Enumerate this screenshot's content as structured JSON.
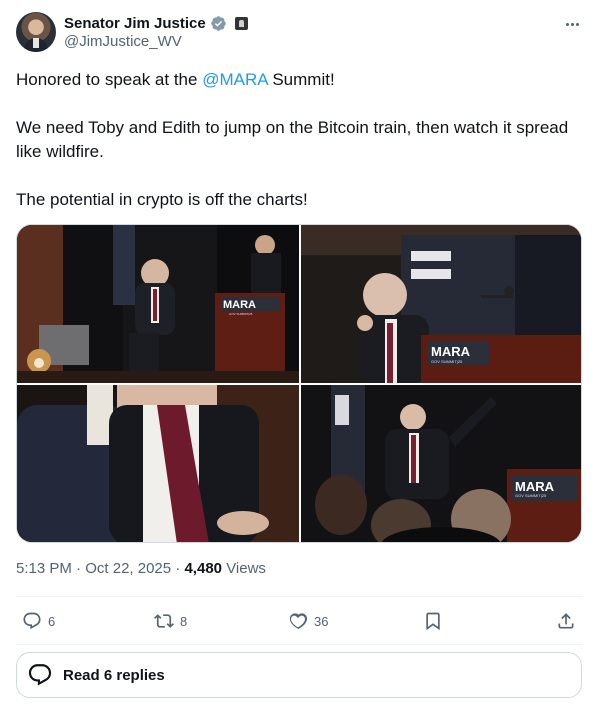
{
  "author": {
    "display_name": "Senator Jim Justice",
    "handle": "@JimJustice_WV",
    "verified": true,
    "badge_icon": "government-affiliation-icon"
  },
  "tweet": {
    "text_before_mention": "Honored to speak at the ",
    "mention": "@MARA",
    "text_after_mention": " Summit!",
    "paragraph_2": "We need Toby and Edith to jump on the Bitcoin train, then watch it spread like wildfire.",
    "paragraph_3": "The potential in crypto is off the charts!"
  },
  "media": {
    "photos": [
      {
        "description_icon": "photo-stage-seated",
        "sign_text": "MARA",
        "sign_subtext": "GOV SUMMIT|25"
      },
      {
        "description_icon": "photo-speaker-closeup",
        "sign_text": "MARA",
        "sign_subtext": "GOV SUMMIT|25"
      },
      {
        "description_icon": "photo-side-profile"
      },
      {
        "description_icon": "photo-audience-view",
        "sign_text": "MARA",
        "sign_subtext": "GOV SUMMIT|25"
      }
    ]
  },
  "meta": {
    "time": "5:13 PM",
    "separator": "·",
    "date": "Oct 22, 2025",
    "views_count": "4,480",
    "views_label": "Views"
  },
  "actions": {
    "replies": "6",
    "reposts": "8",
    "likes": "36"
  },
  "read_replies_label": "Read 6 replies",
  "colors": {
    "accent": "#1d9bf0",
    "text": "#0f1419",
    "secondary": "#536471",
    "border": "#cfd9de"
  }
}
